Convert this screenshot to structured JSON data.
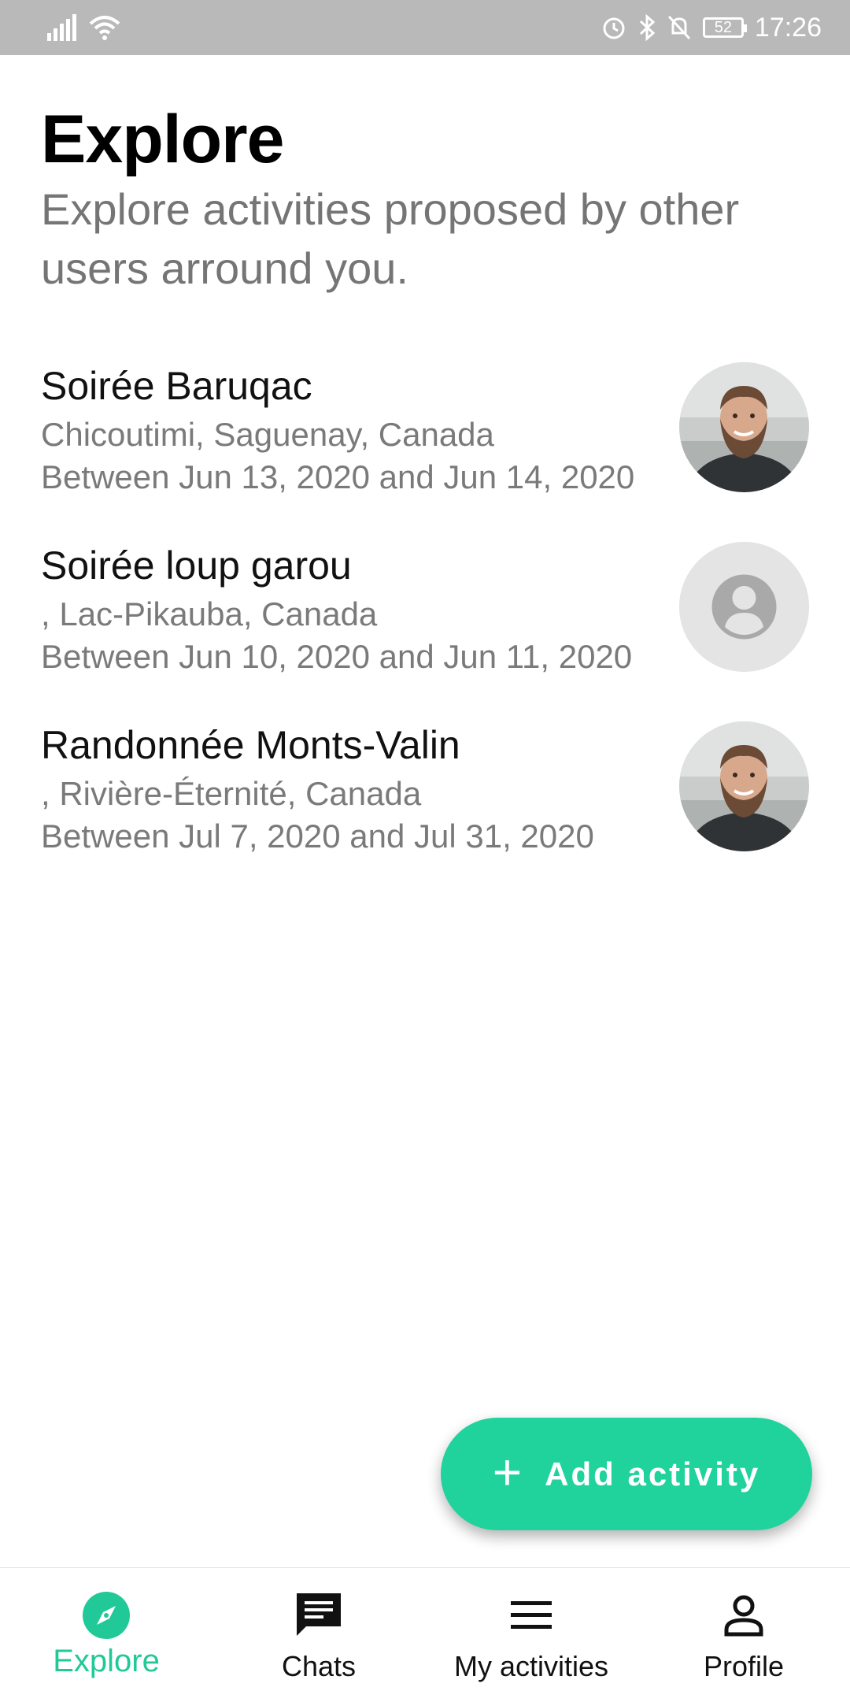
{
  "status_bar": {
    "time": "17:26",
    "battery": "52",
    "icons": [
      "signal-icon",
      "wifi-icon",
      "alarm-icon",
      "bluetooth-icon",
      "mute-icon",
      "battery-icon"
    ]
  },
  "header": {
    "title": "Explore",
    "subtitle": "Explore activities proposed by other users arround you."
  },
  "activities": [
    {
      "name": "Soirée Baruqac",
      "location": "Chicoutimi, Saguenay, Canada",
      "dates": "Between Jun 13, 2020 and Jun 14, 2020",
      "avatar": "user-photo"
    },
    {
      "name": "Soirée loup garou",
      "location": ", Lac-Pikauba, Canada",
      "dates": "Between Jun 10, 2020 and Jun 11, 2020",
      "avatar": "default-person-icon"
    },
    {
      "name": "Randonnée Monts-Valin",
      "location": ", Rivière-Éternité, Canada",
      "dates": "Between Jul 7, 2020 and Jul 31, 2020",
      "avatar": "user-photo"
    }
  ],
  "fab": {
    "label": "Add activity",
    "icon": "plus-icon",
    "color": "#20d29c"
  },
  "bottom_nav": [
    {
      "label": "Explore",
      "icon": "compass-icon",
      "active": true
    },
    {
      "label": "Chats",
      "icon": "chat-icon",
      "active": false
    },
    {
      "label": "My activities",
      "icon": "menu-icon",
      "active": false
    },
    {
      "label": "Profile",
      "icon": "person-icon",
      "active": false
    }
  ],
  "colors": {
    "accent": "#20c997",
    "status_bar": "#b9b9b9",
    "secondary_text": "#757575"
  }
}
